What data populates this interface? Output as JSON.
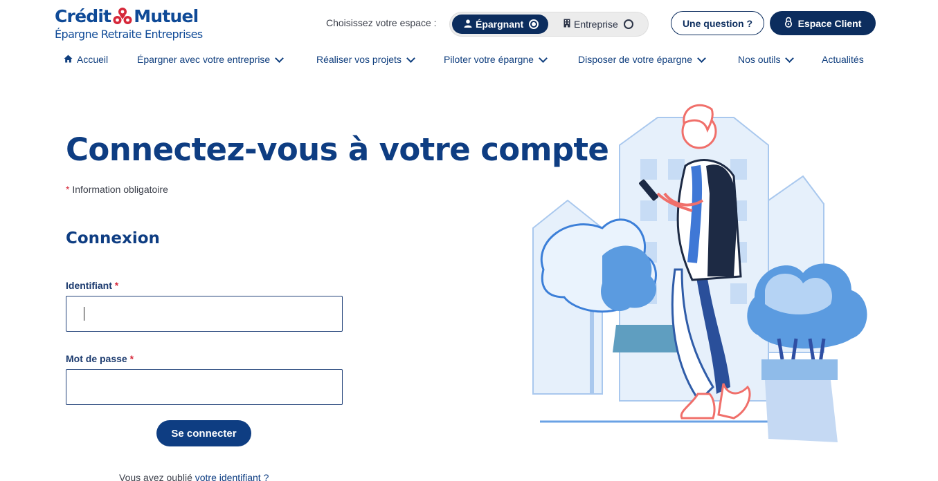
{
  "brand": {
    "word_left": "Crédit",
    "word_right": "Mutuel",
    "subtitle": "Épargne Retraite Entreprises",
    "mark_icon": "credit-mutuel-logo-mark",
    "color": "#0f4a97",
    "mark_color": "#d6283a"
  },
  "header": {
    "space_label": "Choisissez votre espace :",
    "space_options": [
      {
        "label": "Épargnant",
        "icon": "person-icon",
        "selected": true
      },
      {
        "label": "Entreprise",
        "icon": "building-icon",
        "selected": false
      }
    ],
    "question_button": "Une question ?",
    "client_button": "Espace Client",
    "client_icon": "lock-icon"
  },
  "nav": {
    "items": [
      {
        "label": "Accueil",
        "icon": "home-icon",
        "has_menu": false
      },
      {
        "label": "Épargner avec votre entreprise",
        "has_menu": true
      },
      {
        "label": "Réaliser vos projets",
        "has_menu": true
      },
      {
        "label": "Piloter votre épargne",
        "has_menu": true
      },
      {
        "label": "Disposer de votre épargne",
        "has_menu": true
      },
      {
        "label": "Nos outils",
        "has_menu": true
      },
      {
        "label": "Actualités",
        "has_menu": false
      }
    ]
  },
  "main": {
    "title": "Connectez-vous à votre compte",
    "required_mark": "*",
    "required_note": "Information obligatoire",
    "section_title": "Connexion",
    "fields": [
      {
        "label": "Identifiant",
        "required_mark": "*",
        "value": "",
        "placeholder": ""
      },
      {
        "label": "Mot de passe",
        "required_mark": "*",
        "value": "",
        "placeholder": ""
      }
    ],
    "submit_label": "Se connecter",
    "forgot_prefix": "Vous avez oublié",
    "forgot_link": "votre identifiant ?"
  },
  "colors": {
    "primary_dark": "#0c2d5e",
    "primary": "#0e3d82",
    "required": "#d6283a",
    "illustration_blue": "#5b9be0"
  }
}
